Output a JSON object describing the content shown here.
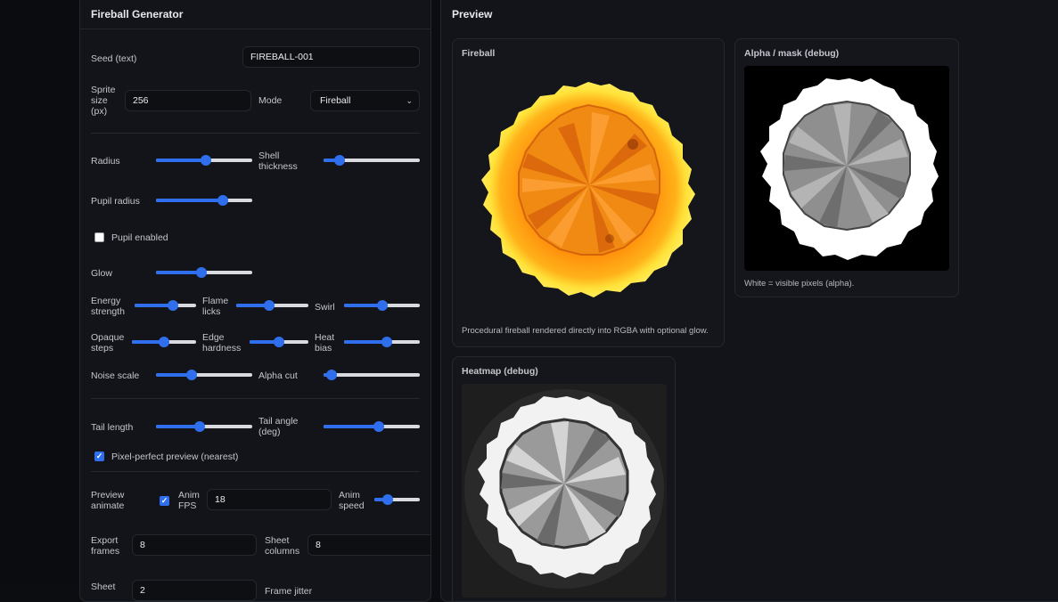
{
  "generator": {
    "title": "Fireball Generator",
    "seed_label": "Seed (text)",
    "seed_value": "FIREBALL-001",
    "sprite_size_label_1": "Sprite",
    "sprite_size_label_2": "size",
    "sprite_size_label_3": "(px)",
    "sprite_size_value": "256",
    "mode_label": "Mode",
    "mode_value": "Fireball",
    "radius_label": "Radius",
    "radius_level": 0.52,
    "shell_label_1": "Shell",
    "shell_label_2": "thickness",
    "shell_level": 0.17,
    "pupil_radius_label": "Pupil radius",
    "pupil_radius_level": 0.69,
    "pupil_enabled_label": "Pupil enabled",
    "pupil_enabled": false,
    "glow_label": "Glow",
    "glow_level": 0.47,
    "energy_label_1": "Energy",
    "energy_label_2": "strength",
    "energy_level": 0.62,
    "flame_label_1": "Flame",
    "flame_label_2": "licks",
    "flame_level": 0.46,
    "swirl_label": "Swirl",
    "swirl_level": 0.51,
    "opaque_label_1": "Opaque",
    "opaque_label_2": "steps",
    "opaque_level": 0.5,
    "edge_label_1": "Edge",
    "edge_label_2": "hardness",
    "edge_level": 0.5,
    "heat_label_1": "Heat",
    "heat_label_2": "bias",
    "heat_level": 0.56,
    "noise_label": "Noise scale",
    "noise_level": 0.37,
    "alpha_cut_label": "Alpha cut",
    "alpha_cut_level": 0.08,
    "tail_length_label": "Tail length",
    "tail_length_level": 0.45,
    "tail_angle_label_1": "Tail angle",
    "tail_angle_label_2": "(deg)",
    "tail_angle_level": 0.57,
    "pixel_perfect_label": "Pixel-perfect preview (nearest)",
    "pixel_perfect": true,
    "preview_label_1": "Preview",
    "preview_label_2": "animate",
    "preview_animate": true,
    "anim_fps_label_1": "Anim",
    "anim_fps_label_2": "FPS",
    "anim_fps_value": "18",
    "anim_speed_label_1": "Anim",
    "anim_speed_label_2": "speed",
    "anim_speed_level": 0.3,
    "export_frames_label_1": "Export",
    "export_frames_label_2": "frames",
    "export_frames_value": "8",
    "sheet_columns_label_1": "Sheet",
    "sheet_columns_label_2": "columns",
    "sheet_columns_value": "8",
    "sheet_label": "Sheet",
    "sheet_value": "2",
    "frame_jitter_label": "Frame jitter"
  },
  "preview": {
    "title": "Preview",
    "fireball_title": "Fireball",
    "fireball_caption": "Procedural fireball rendered directly into RGBA with optional glow.",
    "alpha_title": "Alpha / mask (debug)",
    "alpha_caption": "White = visible pixels (alpha).",
    "heatmap_title": "Heatmap (debug)"
  },
  "colors": {
    "accent": "#2f6fed",
    "background": "#0c0d10",
    "panel": "#131419"
  }
}
